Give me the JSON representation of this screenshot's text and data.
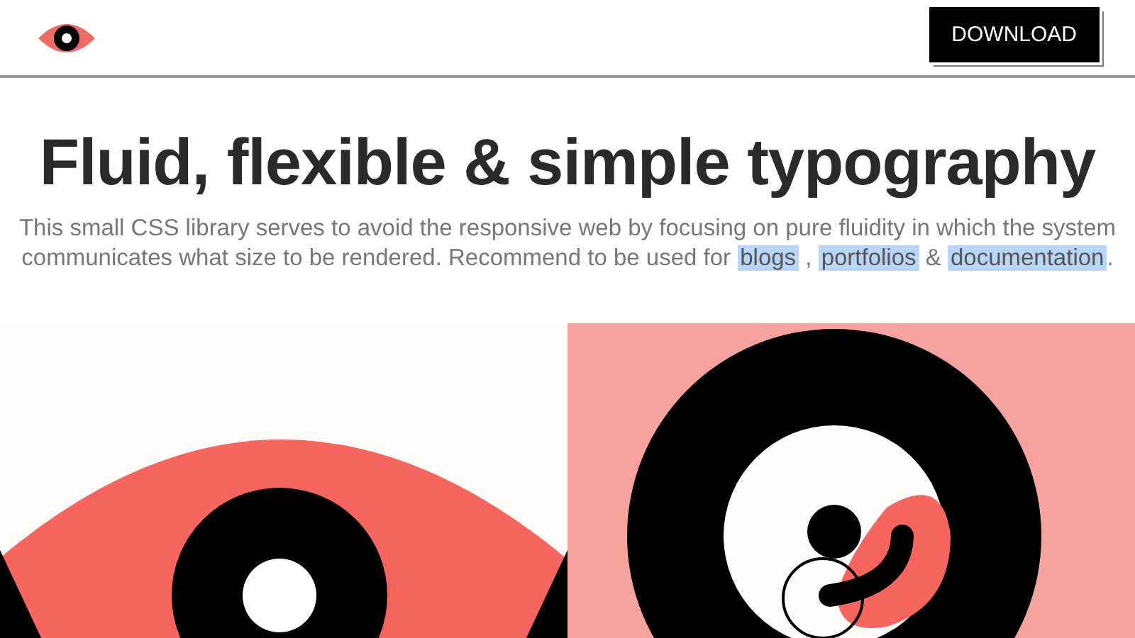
{
  "header": {
    "button": "DOWNLOAD"
  },
  "hero": {
    "title": "Fluid, flexible & simple typography",
    "intro": {
      "text": "This small CSS library serves to avoid the responsive web by focusing on pure fluidity in which the system communicates what size to be rendered. Recommend to be used for ",
      "links": [
        {
          "label": "blogs",
          "highlighted": true
        },
        {
          "label": "portfolios",
          "highlighted": true
        },
        {
          "label": "documentation",
          "highlighted": true
        }
      ],
      "separators": [
        ",",
        "&",
        "."
      ]
    }
  }
}
